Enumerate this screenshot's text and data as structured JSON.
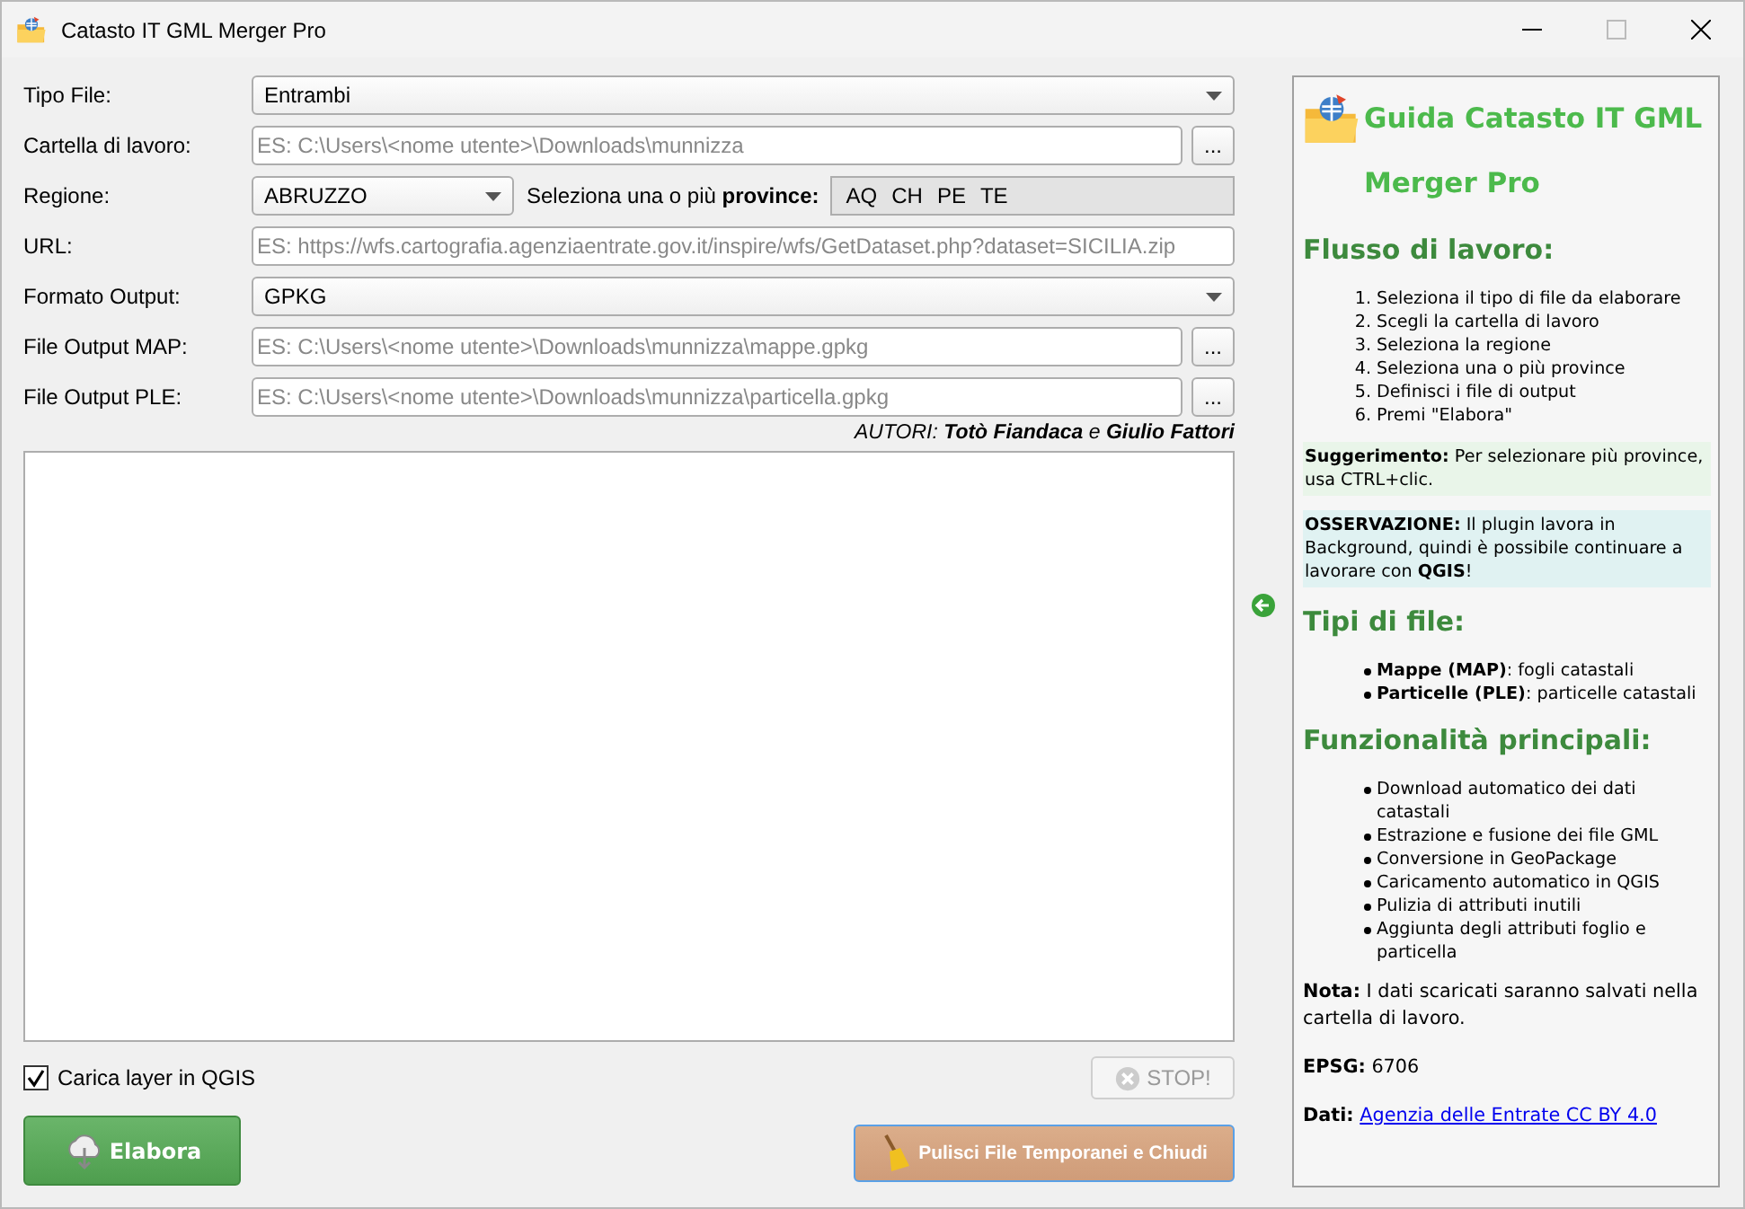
{
  "window": {
    "title": "Catasto IT GML Merger Pro"
  },
  "form": {
    "rows": [
      {
        "kind": "combo",
        "label": "Tipo File:",
        "value": "Entrambi"
      },
      {
        "kind": "browse",
        "label": "Cartella di lavoro:",
        "placeholder": "ES: C:\\Users\\<nome utente>\\Downloads\\munnizza"
      },
      {
        "kind": "region",
        "label": "Regione:",
        "value": "ABRUZZO",
        "provinces_label": "Seleziona una o più **province:**",
        "provinces": [
          {
            "label": "AQ",
            "selected": false
          },
          {
            "label": "CH",
            "selected": false
          },
          {
            "label": "PE",
            "selected": false
          },
          {
            "label": "TE",
            "selected": false
          }
        ]
      },
      {
        "kind": "field",
        "label": "URL:",
        "placeholder": "ES: https://wfs.cartografia.agenziaentrate.gov.it/inspire/wfs/GetDataset.php?dataset=SICILIA.zip"
      },
      {
        "kind": "combo",
        "label": "Formato Output:",
        "value": "GPKG"
      },
      {
        "kind": "browse",
        "label": "File Output MAP:",
        "placeholder": "ES: C:\\Users\\<nome utente>\\Downloads\\munnizza\\mappe.gpkg"
      },
      {
        "kind": "browse",
        "label": "File Output PLE:",
        "placeholder": "ES: C:\\Users\\<nome utente>\\Downloads\\munnizza\\particella.gpkg"
      }
    ],
    "browse_label": "...",
    "authors": "AUTORI: **Totò Fiandaca** e **Giulio Fattori**"
  },
  "load_layer": {
    "label": "Carica layer in QGIS",
    "checked": true
  },
  "stop_button": {
    "label": "STOP!",
    "disabled": true
  },
  "process_button": {
    "label": "Elabora"
  },
  "clean_button": {
    "label": "Pulisci File Temporanei e Chiudi"
  },
  "guide": {
    "title": "Guida Catasto IT GML Merger Pro",
    "blocks": [
      {
        "kind": "heading",
        "text": "Flusso di lavoro:"
      },
      {
        "kind": "ordered",
        "items": [
          {
            "marker": "1.",
            "text": "Seleziona il tipo di file da elaborare"
          },
          {
            "marker": "2.",
            "text": "Scegli la cartella di lavoro"
          },
          {
            "marker": "3.",
            "text": "Seleziona la regione"
          },
          {
            "marker": "4.",
            "text": "Seleziona una o più province"
          },
          {
            "marker": "5.",
            "text": "Definisci i file di output"
          },
          {
            "marker": "6.",
            "text": "Premi \"Elabora\""
          }
        ]
      },
      {
        "kind": "note",
        "color": "#e9f5e9",
        "text": "**Suggerimento:** Per selezionare più province, usa CTRL+clic."
      },
      {
        "kind": "note",
        "color": "#e0f2f2",
        "text": "**OSSERVAZIONE:** Il plugin lavora in Background, quindi è possibile continuare a lavorare con **QGIS**!"
      },
      {
        "kind": "heading",
        "text": "Tipi di file:"
      },
      {
        "kind": "bullets",
        "items": [
          "**Mappe (MAP)**: fogli catastali",
          "**Particelle (PLE)**: particelle catastali"
        ]
      },
      {
        "kind": "heading",
        "text": "Funzionalità principali:"
      },
      {
        "kind": "bullets",
        "items": [
          "Download automatico dei dati catastali",
          "Estrazione e fusione dei file GML",
          "Conversione in GeoPackage",
          "Caricamento automatico in QGIS",
          "Pulizia di attributi inutili",
          "Aggiunta degli attributi foglio e particella"
        ]
      },
      {
        "kind": "para",
        "text": "**Nota:** I dati scaricati saranno salvati nella cartella di lavoro."
      },
      {
        "kind": "para",
        "text": "**EPSG:** 6706"
      },
      {
        "kind": "link",
        "label": "Dati:",
        "text": "Agenzia delle Entrate CC BY 4.0"
      }
    ]
  }
}
